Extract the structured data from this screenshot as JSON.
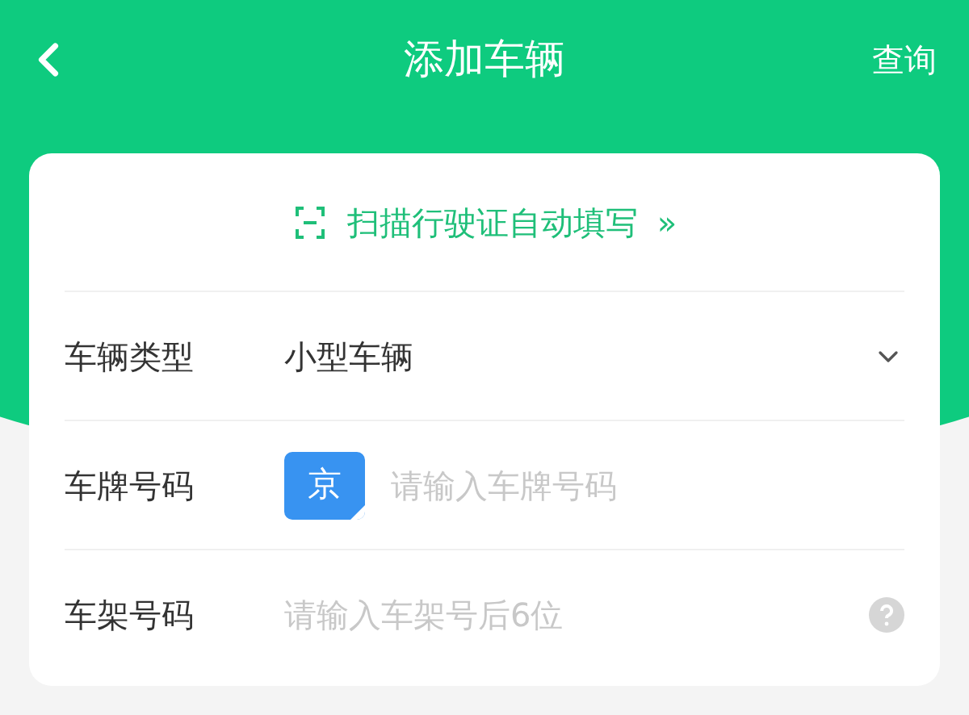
{
  "header": {
    "title": "添加车辆",
    "action": "查询"
  },
  "scan": {
    "label": "扫描行驶证自动填写",
    "arrow": "»"
  },
  "fields": [
    {
      "kind": "select",
      "label": "车辆类型",
      "value": "小型车辆"
    },
    {
      "kind": "plate",
      "label": "车牌号码",
      "prefix": "京",
      "placeholder": "请输入车牌号码"
    },
    {
      "kind": "help",
      "label": "车架号码",
      "placeholder": "请输入车架号后6位"
    }
  ]
}
